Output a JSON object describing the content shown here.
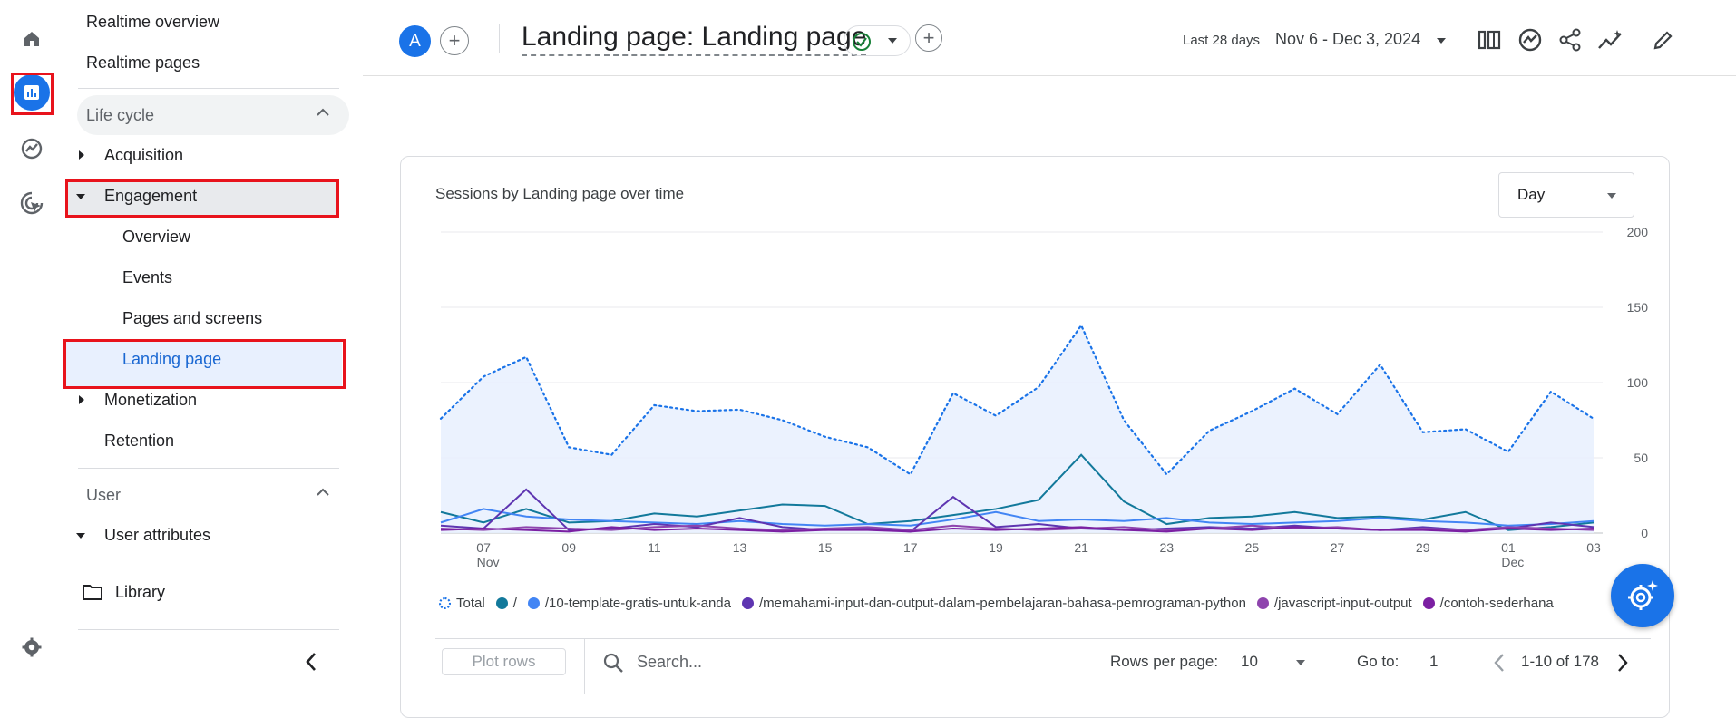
{
  "rail": {
    "items": [
      "home-icon",
      "reports-icon",
      "explore-icon",
      "advertising-icon"
    ],
    "settings_icon": "gear-icon"
  },
  "sidenav": {
    "realtime_overview": "Realtime overview",
    "realtime_pages": "Realtime pages",
    "lifecycle": {
      "label": "Life cycle",
      "acquisition": "Acquisition",
      "engagement": "Engagement",
      "engagement_children": {
        "overview": "Overview",
        "events": "Events",
        "pages_and_screens": "Pages and screens",
        "landing_page": "Landing page"
      },
      "monetization": "Monetization",
      "retention": "Retention"
    },
    "user": {
      "label": "User",
      "user_attributes": "User attributes"
    },
    "library": "Library"
  },
  "header": {
    "avatar_letter": "A",
    "title": "Landing page: Landing page",
    "date_label": "Last 28 days",
    "date_range": "Nov 6 - Dec 3, 2024"
  },
  "card": {
    "title": "Sessions by Landing page over time",
    "granularity": "Day"
  },
  "chart_data": {
    "type": "line",
    "title": "Sessions by Landing page over time",
    "x": [
      "Nov 6",
      "Nov 7",
      "Nov 8",
      "Nov 9",
      "Nov 10",
      "Nov 11",
      "Nov 12",
      "Nov 13",
      "Nov 14",
      "Nov 15",
      "Nov 16",
      "Nov 17",
      "Nov 18",
      "Nov 19",
      "Nov 20",
      "Nov 21",
      "Nov 22",
      "Nov 23",
      "Nov 24",
      "Nov 25",
      "Nov 26",
      "Nov 27",
      "Nov 28",
      "Nov 29",
      "Nov 30",
      "Dec 1",
      "Dec 2",
      "Dec 3"
    ],
    "x_tick_labels": [
      {
        "label": "07",
        "sub": "Nov"
      },
      {
        "label": "09",
        "sub": ""
      },
      {
        "label": "11",
        "sub": ""
      },
      {
        "label": "13",
        "sub": ""
      },
      {
        "label": "15",
        "sub": ""
      },
      {
        "label": "17",
        "sub": ""
      },
      {
        "label": "19",
        "sub": ""
      },
      {
        "label": "21",
        "sub": ""
      },
      {
        "label": "23",
        "sub": ""
      },
      {
        "label": "25",
        "sub": ""
      },
      {
        "label": "27",
        "sub": ""
      },
      {
        "label": "29",
        "sub": ""
      },
      {
        "label": "01",
        "sub": "Dec"
      },
      {
        "label": "03",
        "sub": ""
      }
    ],
    "y_ticks": [
      0,
      50,
      100,
      150,
      200
    ],
    "ylim": [
      0,
      200
    ],
    "grid": true,
    "series": [
      {
        "name": "Total",
        "color": "#1a73e8",
        "style": "dotted-area",
        "values": [
          76,
          104,
          117,
          57,
          52,
          85,
          81,
          82,
          75,
          64,
          57,
          39,
          93,
          78,
          97,
          138,
          75,
          39,
          68,
          81,
          96,
          79,
          112,
          67,
          69,
          54,
          94,
          76
        ]
      },
      {
        "name": "/",
        "color": "#12799b",
        "values": [
          14,
          7,
          16,
          7,
          8,
          13,
          11,
          15,
          19,
          18,
          6,
          8,
          12,
          16,
          22,
          52,
          21,
          6,
          10,
          11,
          14,
          10,
          11,
          9,
          14,
          2,
          4,
          7
        ]
      },
      {
        "name": "/10-template-gratis-untuk-anda",
        "color": "#4285f4",
        "values": [
          7,
          16,
          11,
          9,
          8,
          7,
          6,
          8,
          6,
          5,
          6,
          5,
          9,
          14,
          8,
          9,
          8,
          10,
          7,
          6,
          7,
          8,
          10,
          8,
          7,
          5,
          6,
          8
        ]
      },
      {
        "name": "/memahami-input-dan-output-dalam-pembelajaran-bahasa-pemrograman-python",
        "color": "#5e35b1",
        "values": [
          5,
          3,
          29,
          2,
          3,
          6,
          4,
          10,
          4,
          2,
          3,
          1,
          24,
          4,
          6,
          3,
          2,
          3,
          4,
          3,
          5,
          3,
          2,
          4,
          2,
          3,
          7,
          4
        ]
      },
      {
        "name": "/javascript-input-output",
        "color": "#8e44ad",
        "values": [
          3,
          2,
          4,
          3,
          2,
          4,
          5,
          3,
          2,
          3,
          4,
          2,
          5,
          3,
          2,
          3,
          4,
          2,
          3,
          5,
          3,
          4,
          2,
          3,
          2,
          4,
          3,
          2
        ]
      },
      {
        "name": "/contoh-sederhana",
        "color": "#7b1fa2",
        "values": [
          2,
          3,
          2,
          1,
          4,
          2,
          3,
          2,
          1,
          2,
          2,
          1,
          3,
          2,
          3,
          4,
          2,
          1,
          3,
          2,
          4,
          3,
          2,
          2,
          1,
          3,
          2,
          3
        ]
      }
    ]
  },
  "table_controls": {
    "plot_rows": "Plot rows",
    "search_placeholder": "Search...",
    "rows_per_page_label": "Rows per page:",
    "rows_per_page_value": "10",
    "goto_label": "Go to:",
    "goto_value": "1",
    "range_text": "1-10 of 178"
  }
}
